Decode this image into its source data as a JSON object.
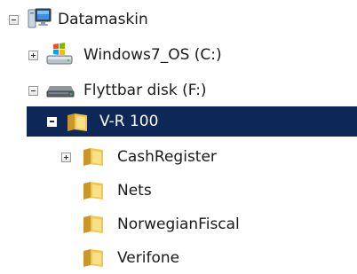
{
  "tree": {
    "root": {
      "label": "Datamaskin",
      "expanded": true,
      "icon": "computer-icon"
    },
    "drives": [
      {
        "label": "Windows7_OS (C:)",
        "expanded": false,
        "icon": "windows-drive-icon"
      },
      {
        "label": "Flyttbar disk (F:)",
        "expanded": true,
        "icon": "removable-drive-icon"
      }
    ],
    "selected_folder": {
      "label": "V-R 100",
      "expanded": true,
      "icon": "folder-icon"
    },
    "subfolders": [
      {
        "label": "CashRegister",
        "expandable": true,
        "icon": "folder-icon"
      },
      {
        "label": "Nets",
        "expandable": false,
        "icon": "folder-icon"
      },
      {
        "label": "NorwegianFiscal",
        "expandable": false,
        "icon": "folder-icon"
      },
      {
        "label": "Verifone",
        "expandable": false,
        "icon": "folder-icon"
      }
    ]
  },
  "colors": {
    "selection_background": "#0d2856",
    "selection_text": "#ffffff",
    "text": "#1a1a1a",
    "folder": "#f2c94c"
  }
}
